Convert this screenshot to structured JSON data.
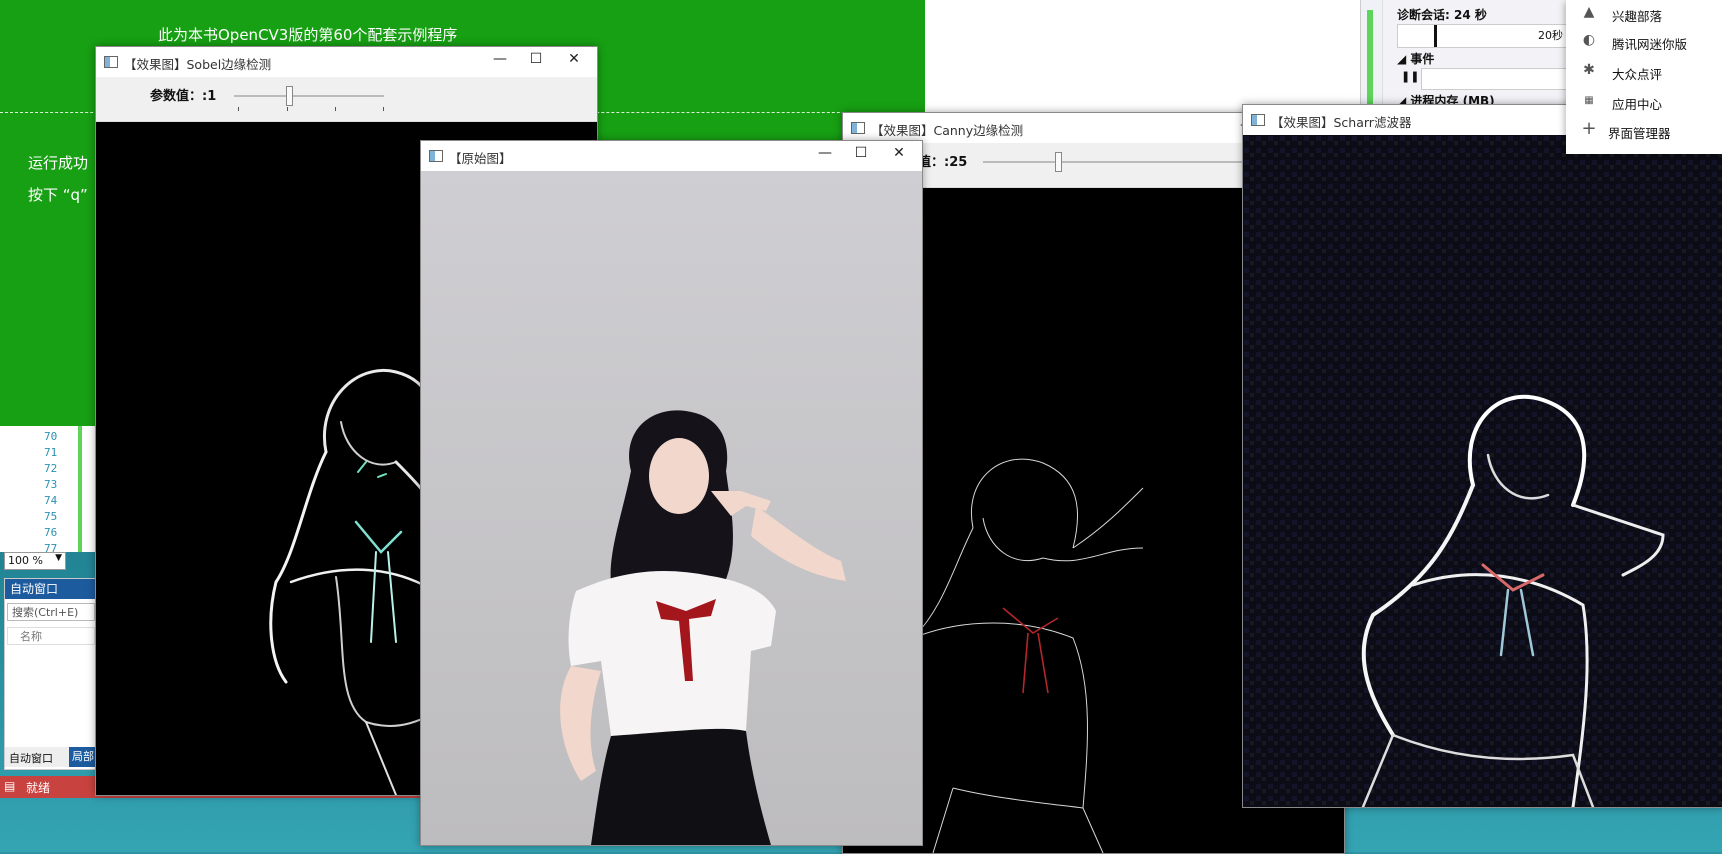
{
  "console": {
    "header": "此为本书OpenCV3版的第60个配套示例程序",
    "line1": "运行成功",
    "line2": "按下 “q”"
  },
  "vs": {
    "line_numbers": [
      "70",
      "71",
      "72",
      "73",
      "74",
      "75",
      "76",
      "77"
    ],
    "zoom": "100 %",
    "autos": {
      "title": "自动窗口",
      "search_placeholder": "搜索(Ctrl+E)",
      "column_name": "名称",
      "tab_autos": "自动窗口",
      "tab_locals": "局部"
    },
    "status": "就绪"
  },
  "diagnostics": {
    "session": "诊断会话: 24 秒",
    "timeline_label": "20秒",
    "events": "事件",
    "memory": "进程内存 (MB)"
  },
  "menu": {
    "items": [
      {
        "icon": "triangle-icon",
        "label": "兴趣部落"
      },
      {
        "icon": "qq-mini-icon",
        "label": "腾讯网迷你版"
      },
      {
        "icon": "review-icon",
        "label": "大众点评"
      },
      {
        "icon": "app-icon",
        "label": "应用中心"
      },
      {
        "icon": "plus-icon",
        "label": "界面管理器"
      }
    ]
  },
  "windows": {
    "sobel": {
      "title": "【效果图】Sobel边缘检测",
      "trackbar_label": "参数值：:1",
      "trackbar_value": 1,
      "trackbar_max": 3
    },
    "original": {
      "title": "【原始图】"
    },
    "canny": {
      "title": "【效果图】Canny边缘检测",
      "trackbar_label": "值：:25",
      "trackbar_value": 25
    },
    "scharr": {
      "title": "【效果图】Scharr滤波器"
    }
  },
  "colors": {
    "console_green": "#17a013",
    "status_red": "#c8433f",
    "vs_blue": "#1c5b9e",
    "ribbon_red": "#a3161b"
  }
}
